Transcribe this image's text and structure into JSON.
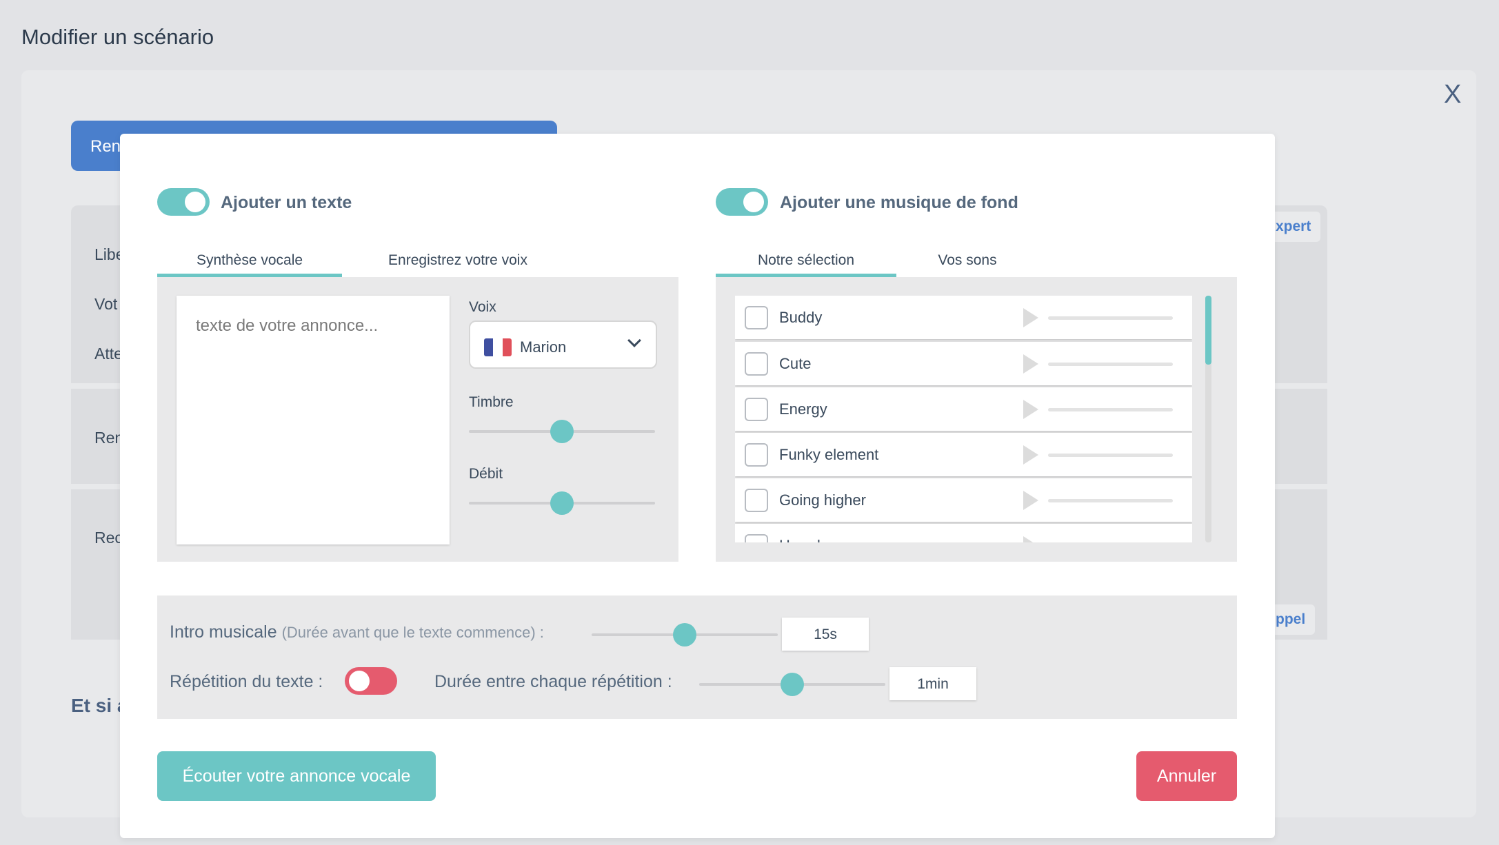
{
  "page_title": "Modifier un scénario",
  "close_label": "X",
  "background": {
    "blue_button_label": "Ren",
    "labels": [
      "Libe",
      "Vot",
      "Atte",
      "Ren",
      "Rec"
    ],
    "link_expert": "xpert",
    "link_appel": "ppel",
    "heading": "Et si a"
  },
  "modal": {
    "text_section": {
      "title": "Ajouter un texte",
      "enabled": true,
      "tabs": [
        {
          "label": "Synthèse vocale",
          "active": true
        },
        {
          "label": "Enregistrez votre voix",
          "active": false
        }
      ],
      "textarea_placeholder": "texte de votre annonce...",
      "voice_label": "Voix",
      "voice_value": "Marion",
      "voice_flag": "fr-flag-icon",
      "timbre_label": "Timbre",
      "timbre_value": 0.5,
      "debit_label": "Débit",
      "debit_value": 0.5
    },
    "music_section": {
      "title": "Ajouter une musique de fond",
      "enabled": true,
      "tabs": [
        {
          "label": "Notre sélection",
          "active": true
        },
        {
          "label": "Vos sons",
          "active": false
        }
      ],
      "tracks": [
        "Buddy",
        "Cute",
        "Energy",
        "Funky element",
        "Going higher",
        "Hoard"
      ]
    },
    "options": {
      "intro_label": "Intro musicale",
      "intro_hint": "(Durée avant que le texte commence) :",
      "intro_value": "15s",
      "intro_slider": 0.5,
      "repeat_label": "Répétition du texte :",
      "repeat_enabled": false,
      "interval_label": "Durée entre chaque répétition :",
      "interval_value": "1min",
      "interval_slider": 0.5
    },
    "buttons": {
      "listen": "Écouter votre annonce vocale",
      "cancel": "Annuler"
    }
  },
  "colors": {
    "accent": "#6cc6c5",
    "danger": "#e55b6e",
    "primary": "#4a7fcc"
  }
}
